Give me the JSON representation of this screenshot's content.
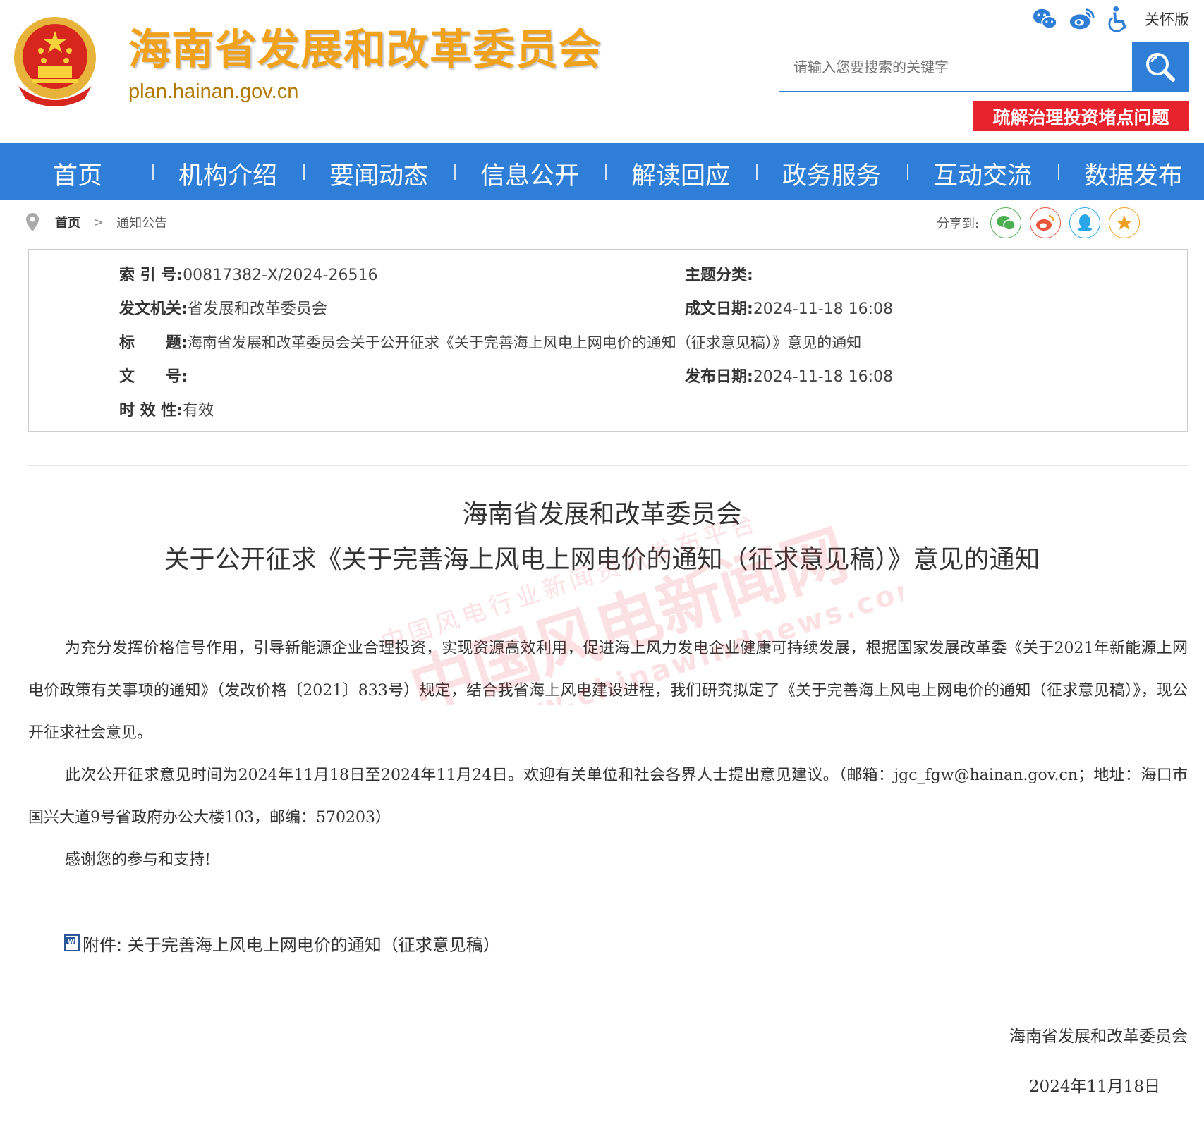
{
  "header": {
    "site_title": "海南省发展和改革委员会",
    "site_url": "plan.hainan.gov.cn",
    "care_mode_label": "关怀版",
    "search_placeholder": "请输入您要搜索的关键字",
    "promo_label": "疏解治理投资堵点问题",
    "icons": [
      "wechat-icon",
      "weibo-icon",
      "accessibility-icon",
      "search-icon"
    ]
  },
  "nav": {
    "items": [
      "首页",
      "机构介绍",
      "要闻动态",
      "信息公开",
      "解读回应",
      "政务服务",
      "互动交流",
      "数据发布"
    ]
  },
  "breadcrumb": {
    "home": "首页",
    "current": "通知公告"
  },
  "share": {
    "label": "分享到:",
    "targets": [
      "wechat-icon",
      "weibo-icon",
      "qq-icon",
      "favorite-icon"
    ]
  },
  "meta": {
    "index_label": "索 引 号:",
    "index_value": "00817382-X/2024-26516",
    "topic_label": "主题分类:",
    "topic_value": "",
    "issuer_label": "发文机关:",
    "issuer_value": "省发展和改革委员会",
    "created_label": "成文日期:",
    "created_value": "2024-11-18 16:08",
    "title_label": "标　　题:",
    "title_value": "海南省发展和改革委员会关于公开征求《关于完善海上风电上网电价的通知（征求意见稿）》意见的通知",
    "docno_label": "文　　号:",
    "docno_value": "",
    "published_label": "发布日期:",
    "published_value": "2024-11-18 16:08",
    "validity_label": "时 效 性:",
    "validity_value": "有效"
  },
  "article": {
    "title_line1": "海南省发展和改革委员会",
    "title_line2": "关于公开征求《关于完善海上风电上网电价的通知（征求意见稿）》意见的通知",
    "p1": "为充分发挥价格信号作用，引导新能源企业合理投资，实现资源高效利用，促进海上风力发电企业健康可持续发展，根据国家发展改革委《关于2021年新能源上网电价政策有关事项的通知》（发改价格〔2021〕833号）规定，结合我省海上风电建设进程，我们研究拟定了《关于完善海上风电上网电价的通知（征求意见稿）》，现公开征求社会意见。",
    "p2": "此次公开征求意见时间为2024年11月18日至2024年11月24日。欢迎有关单位和社会各界人士提出意见建议。（邮箱：jgc_fgw@hainan.gov.cn；地址：海口市国兴大道9号省政府办公大楼103，邮编：570203）",
    "p3": "感谢您的参与和支持!",
    "attachment": "附件: 关于完善海上风电上网电价的通知（征求意见稿）",
    "signature": "海南省发展和改革委员会",
    "date": "2024年11月18日"
  },
  "watermark": {
    "line1": "中国风电行业新闻资讯发布平台",
    "line2": "中国风电新闻网",
    "line3": "www.chinawindnews.com"
  },
  "colors": {
    "nav_blue": "#2f7ed8",
    "title_orange": "#f1a21c",
    "promo_red": "#e8232e"
  }
}
